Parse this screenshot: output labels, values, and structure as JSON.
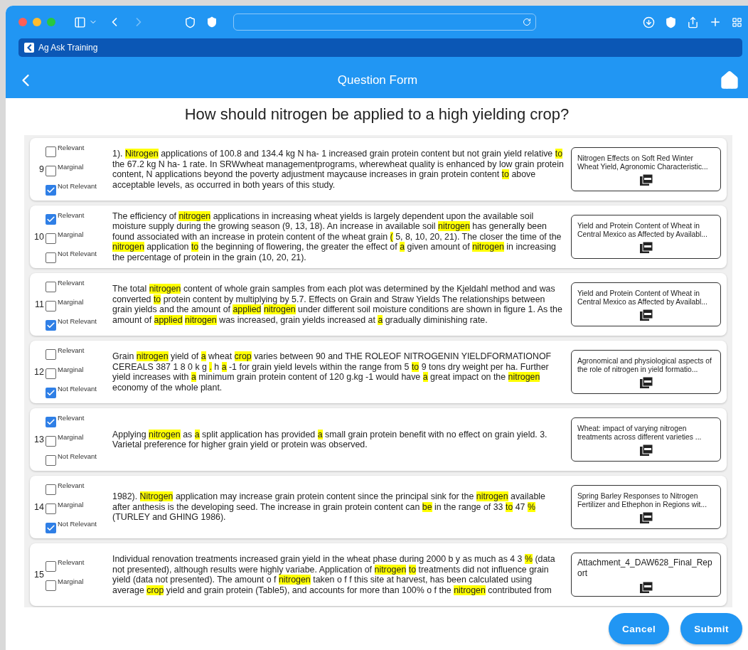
{
  "browser": {
    "tab_title": "Ag Ask Training",
    "back_enabled": true,
    "forward_enabled": false
  },
  "app_bar": {
    "title": "Question Form"
  },
  "question": "How should nitrogen be applied to a high yielding crop?",
  "results": [
    {
      "number": "9",
      "options": [
        {
          "label": "Relevant",
          "checked": false
        },
        {
          "label": "Marginal",
          "checked": false
        },
        {
          "label": "Not Relevant",
          "checked": true
        }
      ],
      "passage": [
        {
          "text": "1). ",
          "highlighted": false
        },
        {
          "text": "Nitrogen",
          "highlighted": true
        },
        {
          "text": " applications of 100.8 and 134.4 kg N ha- 1 increased grain protein content but not grain yield relative ",
          "highlighted": false
        },
        {
          "text": "to",
          "highlighted": true
        },
        {
          "text": " the 67.2 kg N ha- 1 rate. In SRWwheat managementprograms, wherewheat quality is enhanced by low grain protein content, N applications beyond the poverty adjustment maycause increases in grain protein content ",
          "highlighted": false
        },
        {
          "text": "to",
          "highlighted": true
        },
        {
          "text": " above acceptable levels, as occurred in both years of this study.",
          "highlighted": false
        }
      ],
      "source": "Nitrogen Effects on Soft Red Winter Wheat Yield, Agronomic Characteristic..."
    },
    {
      "number": "10",
      "options": [
        {
          "label": "Relevant",
          "checked": true
        },
        {
          "label": "Marginal",
          "checked": false
        },
        {
          "label": "Not Relevant",
          "checked": false
        }
      ],
      "passage": [
        {
          "text": "The efficiency of ",
          "highlighted": false
        },
        {
          "text": "nitrogen",
          "highlighted": true
        },
        {
          "text": " applications in increasing wheat yields is largely dependent upon the available soil moisture supply during the growing season (9, 13, 18). An increase in available soil ",
          "highlighted": false
        },
        {
          "text": "nitrogen",
          "highlighted": true
        },
        {
          "text": " has generally been found associated with an increase in protein content of the wheat grain ",
          "highlighted": false
        },
        {
          "text": "(",
          "highlighted": true
        },
        {
          "text": " 5, 8, 10, 20, 21). The closer the time of the ",
          "highlighted": false
        },
        {
          "text": "nitrogen",
          "highlighted": true
        },
        {
          "text": " application ",
          "highlighted": false
        },
        {
          "text": "to",
          "highlighted": true
        },
        {
          "text": " the beginning of flowering, the greater the effect of ",
          "highlighted": false
        },
        {
          "text": "a",
          "highlighted": true
        },
        {
          "text": " given amount of ",
          "highlighted": false
        },
        {
          "text": "nitrogen",
          "highlighted": true
        },
        {
          "text": " in increasing the percentage of protein in the grain (10, 20, 21).",
          "highlighted": false
        }
      ],
      "source": "Yield and Protein Content of Wheat in Central Mexico as Affected by Availabl..."
    },
    {
      "number": "11",
      "options": [
        {
          "label": "Relevant",
          "checked": false
        },
        {
          "label": "Marginal",
          "checked": false
        },
        {
          "label": "Not Relevant",
          "checked": true
        }
      ],
      "passage": [
        {
          "text": "The total ",
          "highlighted": false
        },
        {
          "text": "nitrogen",
          "highlighted": true
        },
        {
          "text": " content of whole grain samples from each plot was determined by the Kjeldahl method and was converted ",
          "highlighted": false
        },
        {
          "text": "to",
          "highlighted": true
        },
        {
          "text": " protein content by multiplying by 5.7. Effects on Grain and Straw Yields The relationships between grain yields and the amount of ",
          "highlighted": false
        },
        {
          "text": "applied ",
          "highlighted": true
        },
        {
          "text": "nitrogen",
          "highlighted": true
        },
        {
          "text": " under different soil moisture conditions are shown in figure 1. As the amount of ",
          "highlighted": false
        },
        {
          "text": "applied ",
          "highlighted": true
        },
        {
          "text": "nitrogen",
          "highlighted": true
        },
        {
          "text": " was increased, grain yields increased at ",
          "highlighted": false
        },
        {
          "text": "a",
          "highlighted": true
        },
        {
          "text": " gradually diminishing rate.",
          "highlighted": false
        }
      ],
      "source": "Yield and Protein Content of Wheat in Central Mexico as Affected by Availabl..."
    },
    {
      "number": "12",
      "options": [
        {
          "label": "Relevant",
          "checked": false
        },
        {
          "label": "Marginal",
          "checked": false
        },
        {
          "label": "Not Relevant",
          "checked": true
        }
      ],
      "passage": [
        {
          "text": "Grain ",
          "highlighted": false
        },
        {
          "text": "nitrogen",
          "highlighted": true
        },
        {
          "text": " yield of ",
          "highlighted": false
        },
        {
          "text": "a",
          "highlighted": true
        },
        {
          "text": " wheat ",
          "highlighted": false
        },
        {
          "text": "crop",
          "highlighted": true
        },
        {
          "text": " varies between 90 and THE ROLEOF NITROGENIN YIELDFORMATIONOF CEREALS 387 1 8 0 k g ",
          "highlighted": false
        },
        {
          "text": ".",
          "highlighted": true
        },
        {
          "text": " h ",
          "highlighted": false
        },
        {
          "text": "a",
          "highlighted": true
        },
        {
          "text": " -1 for grain yield levels within the range from 5 ",
          "highlighted": false
        },
        {
          "text": "to",
          "highlighted": true
        },
        {
          "text": " 9 tons dry weight per ha. Further yield increases with ",
          "highlighted": false
        },
        {
          "text": "a",
          "highlighted": true
        },
        {
          "text": " minimum grain protein content of 120 g.kg -1 would have ",
          "highlighted": false
        },
        {
          "text": "a",
          "highlighted": true
        },
        {
          "text": " great impact on the ",
          "highlighted": false
        },
        {
          "text": "nitrogen",
          "highlighted": true
        },
        {
          "text": " economy of the whole plant.",
          "highlighted": false
        }
      ],
      "source": "Agronomical and physiological aspects of the role of nitrogen in yield formatio..."
    },
    {
      "number": "13",
      "options": [
        {
          "label": "Relevant",
          "checked": true
        },
        {
          "label": "Marginal",
          "checked": false
        },
        {
          "label": "Not Relevant",
          "checked": false
        }
      ],
      "passage": [
        {
          "text": "Applying ",
          "highlighted": false
        },
        {
          "text": "nitrogen",
          "highlighted": true
        },
        {
          "text": " as ",
          "highlighted": false
        },
        {
          "text": "a",
          "highlighted": true
        },
        {
          "text": " split application has provided ",
          "highlighted": false
        },
        {
          "text": "a",
          "highlighted": true
        },
        {
          "text": " small grain protein benefit with no effect on grain yield. 3. Varietal preference for higher grain yield or protein was observed.",
          "highlighted": false
        }
      ],
      "source": "Wheat: impact of varying nitrogen treatments across different varieties ..."
    },
    {
      "number": "14",
      "options": [
        {
          "label": "Relevant",
          "checked": false
        },
        {
          "label": "Marginal",
          "checked": false
        },
        {
          "label": "Not Relevant",
          "checked": true
        }
      ],
      "passage": [
        {
          "text": "1982). ",
          "highlighted": false
        },
        {
          "text": "Nitrogen",
          "highlighted": true
        },
        {
          "text": " application may increase grain protein content since the principal sink for the ",
          "highlighted": false
        },
        {
          "text": "nitrogen",
          "highlighted": true
        },
        {
          "text": " available after anthesis is the developing seed. The increase in grain protein content can ",
          "highlighted": false
        },
        {
          "text": "be",
          "highlighted": true
        },
        {
          "text": " in the range of 33 ",
          "highlighted": false
        },
        {
          "text": "to",
          "highlighted": true
        },
        {
          "text": " 47 ",
          "highlighted": false
        },
        {
          "text": "%",
          "highlighted": true
        },
        {
          "text": " (TURLEY and GHING 1986).",
          "highlighted": false
        }
      ],
      "source": "Spring Barley Responses to Nitrogen Fertilizer and Ethephon in Regions wit..."
    },
    {
      "number": "15",
      "options": [
        {
          "label": "Relevant",
          "checked": false
        },
        {
          "label": "Marginal",
          "checked": false
        }
      ],
      "passage": [
        {
          "text": "Individual renovation treatments increased grain yield in the wheat phase during 2000 b y as much as 4 3 ",
          "highlighted": false
        },
        {
          "text": "%",
          "highlighted": true
        },
        {
          "text": " (data not presented), although results were highly variabe. Application of ",
          "highlighted": false
        },
        {
          "text": "nitrogen ",
          "highlighted": true
        },
        {
          "text": "to",
          "highlighted": true
        },
        {
          "text": " treatments did not influence grain yield (data not presented). The amount o f ",
          "highlighted": false
        },
        {
          "text": "nitrogen",
          "highlighted": true
        },
        {
          "text": " taken o f f this site at harvest, has been calculated using average ",
          "highlighted": false
        },
        {
          "text": "crop",
          "highlighted": true
        },
        {
          "text": " yield and grain protein (Table5), and accounts for more than 100% o f the ",
          "highlighted": false
        },
        {
          "text": "nitrogen",
          "highlighted": true
        },
        {
          "text": " contributed from",
          "highlighted": false
        }
      ],
      "source": "Attachment_4_DAW628_Final_Report",
      "large_source": true
    }
  ],
  "actions": [
    {
      "label": "Cancel"
    },
    {
      "label": "Submit"
    }
  ]
}
